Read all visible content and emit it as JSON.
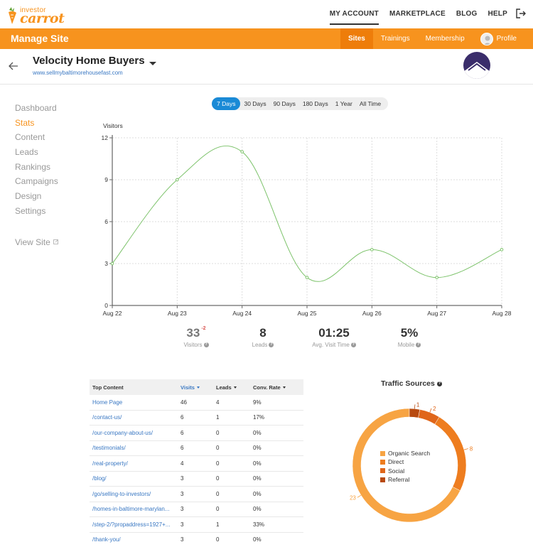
{
  "topnav": {
    "logo_small": "investor",
    "logo_big": "carrot",
    "links": [
      "MY ACCOUNT",
      "MARKETPLACE",
      "BLOG",
      "HELP"
    ],
    "active_link": "MY ACCOUNT"
  },
  "orangebar": {
    "title": "Manage Site",
    "tabs": [
      "Sites",
      "Trainings",
      "Membership"
    ],
    "profile_label": "Profile",
    "colors": {
      "brand": "#f7931e",
      "active_tab": "#ee7d0a"
    }
  },
  "site": {
    "name": "Velocity Home Buyers",
    "url": "www.sellmybaltimorehousefast.com"
  },
  "sidebar": {
    "items": [
      "Dashboard",
      "Stats",
      "Content",
      "Leads",
      "Rankings",
      "Campaigns",
      "Design",
      "Settings"
    ],
    "active": "Stats",
    "view_site": "View Site"
  },
  "ranges": {
    "options": [
      "7 Days",
      "30 Days",
      "90 Days",
      "180 Days",
      "1 Year",
      "All Time"
    ],
    "active": "7 Days"
  },
  "chart_data": {
    "type": "line",
    "ylabel": "Visitors",
    "x": [
      "Aug 22",
      "Aug 23",
      "Aug 24",
      "Aug 25",
      "Aug 26",
      "Aug 27",
      "Aug 28"
    ],
    "values": [
      3,
      9,
      11,
      2,
      4,
      2,
      4
    ],
    "yticks": [
      0,
      3,
      6,
      9,
      12
    ],
    "ylim": [
      0,
      12
    ],
    "grid": true,
    "color": "#7dc36b"
  },
  "kpis": [
    {
      "value": "33",
      "delta": "-2",
      "label": "Visitors"
    },
    {
      "value": "8",
      "label": "Leads"
    },
    {
      "value": "01:25",
      "label": "Avg. Visit Time"
    },
    {
      "value": "5%",
      "label": "Mobile"
    }
  ],
  "top_content": {
    "headers": [
      "Top Content",
      "Visits",
      "Leads",
      "Conv. Rate"
    ],
    "rows": [
      [
        "Home Page",
        "46",
        "4",
        "9%"
      ],
      [
        "/contact-us/",
        "6",
        "1",
        "17%"
      ],
      [
        "/our-company-about-us/",
        "6",
        "0",
        "0%"
      ],
      [
        "/testimonials/",
        "6",
        "0",
        "0%"
      ],
      [
        "/real-property/",
        "4",
        "0",
        "0%"
      ],
      [
        "/blog/",
        "3",
        "0",
        "0%"
      ],
      [
        "/go/selling-to-investors/",
        "3",
        "0",
        "0%"
      ],
      [
        "/homes-in-baltimore-marylan...",
        "3",
        "0",
        "0%"
      ],
      [
        "/step-2/?propaddress=1927+...",
        "3",
        "1",
        "33%"
      ],
      [
        "/thank-you/",
        "3",
        "0",
        "0%"
      ]
    ]
  },
  "traffic": {
    "title": "Traffic Sources",
    "chart_data": {
      "type": "pie",
      "labels": [
        "Organic Search",
        "Direct",
        "Social",
        "Referral"
      ],
      "values": [
        23,
        8,
        2,
        1
      ],
      "colors": [
        "#f7a443",
        "#ee7d1f",
        "#e0661a",
        "#b84a10"
      ]
    }
  }
}
